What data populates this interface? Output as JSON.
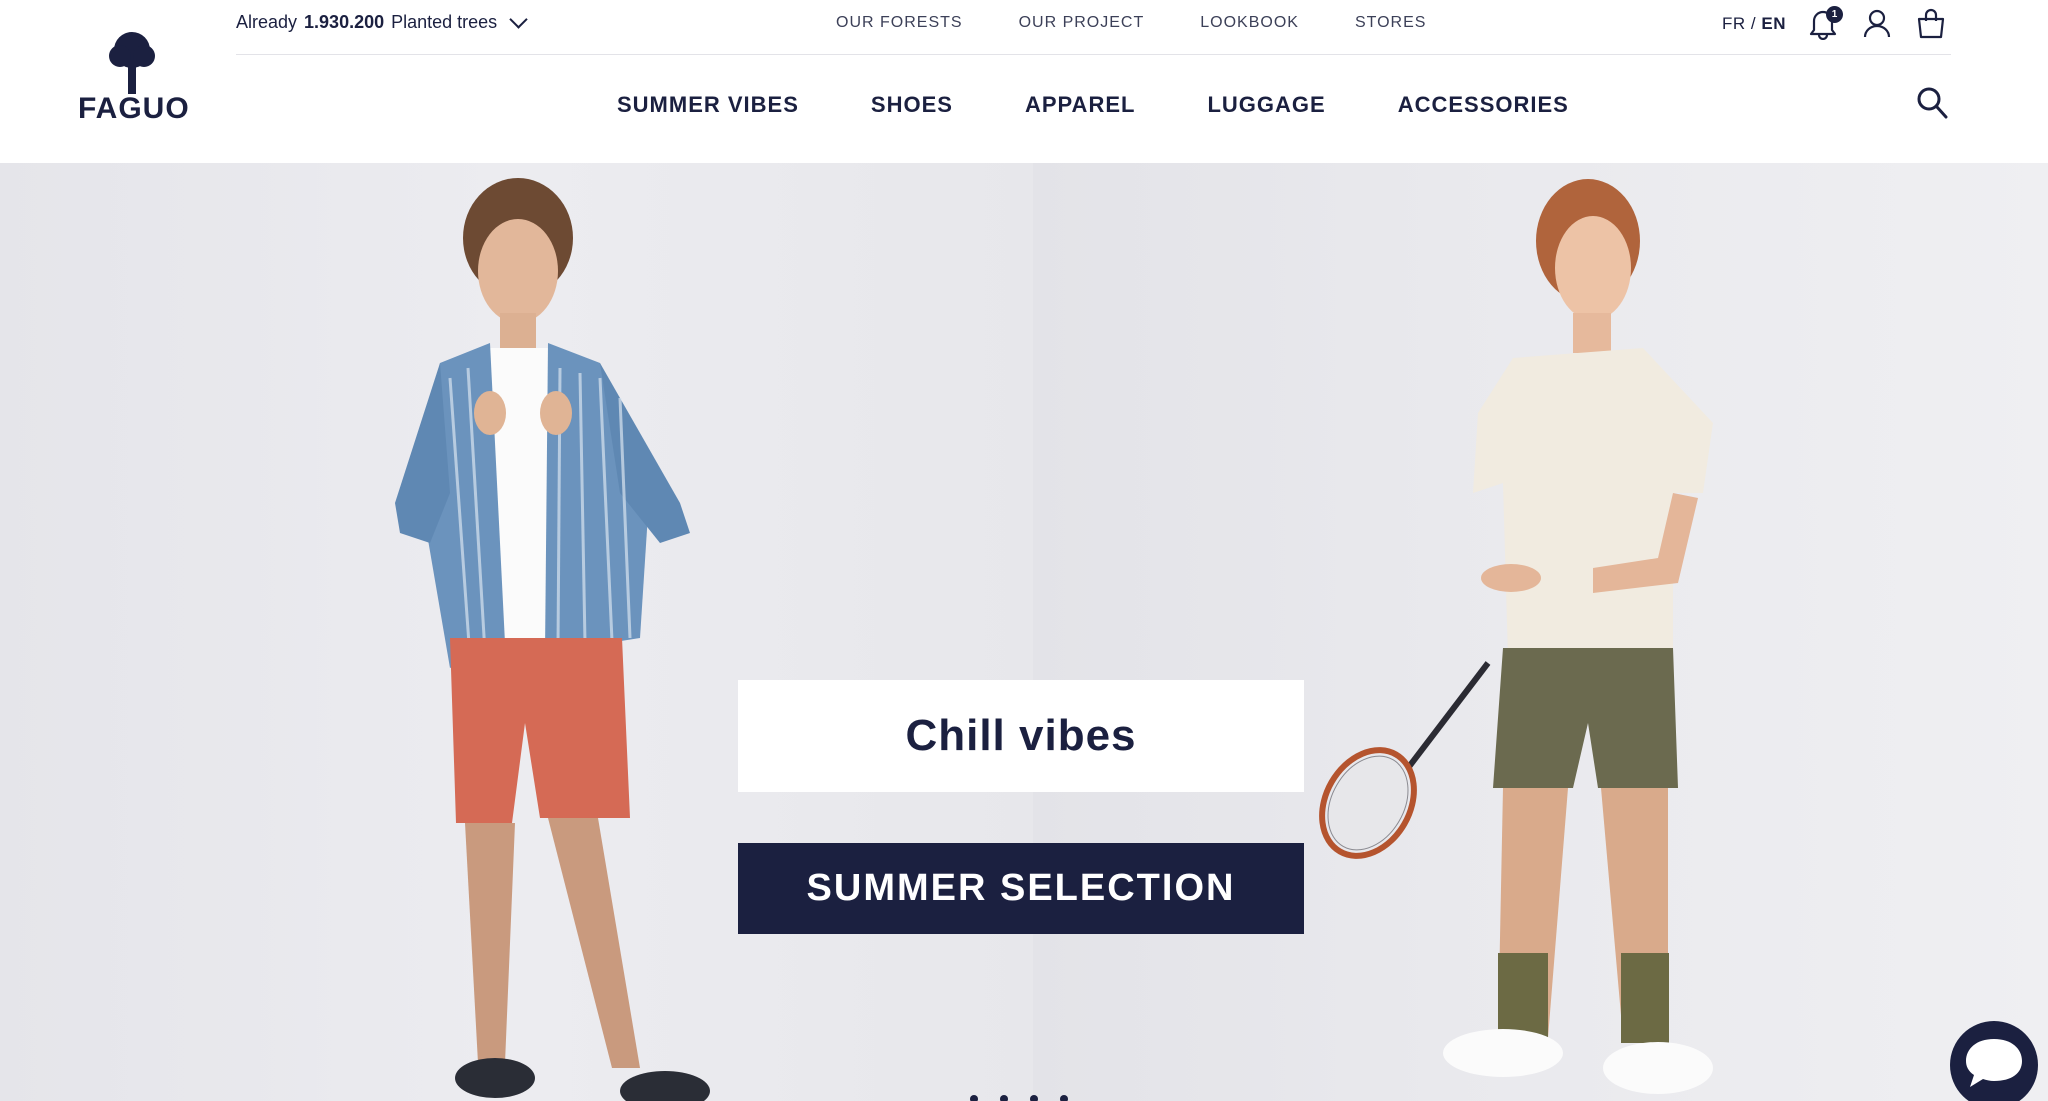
{
  "brand": {
    "name": "FAGUO"
  },
  "topbar": {
    "trees": {
      "prefix": "Already",
      "count": "1.930.200",
      "suffix": "Planted trees"
    },
    "links": [
      "OUR FORESTS",
      "OUR PROJECT",
      "LOOKBOOK",
      "STORES"
    ],
    "lang": {
      "fr": "FR",
      "sep": "/",
      "en": "EN"
    },
    "notifications_count": "1"
  },
  "nav": [
    "SUMMER VIBES",
    "SHOES",
    "APPAREL",
    "LUGGAGE",
    "ACCESSORIES"
  ],
  "hero": {
    "title": "Chill vibes",
    "cta": "SUMMER SELECTION",
    "slides": 4
  },
  "colors": {
    "navy": "#1b2040",
    "shirt_stripe": "#6b93bd",
    "shorts_red": "#d56a55",
    "tee_cream": "#f1ebe0",
    "shorts_olive": "#6b6a4f",
    "socks": "#6c6a44"
  },
  "icons": [
    "tree-logo-icon",
    "chevron-down-icon",
    "bell-icon",
    "user-icon",
    "shopping-bag-icon",
    "search-icon",
    "chat-icon"
  ]
}
